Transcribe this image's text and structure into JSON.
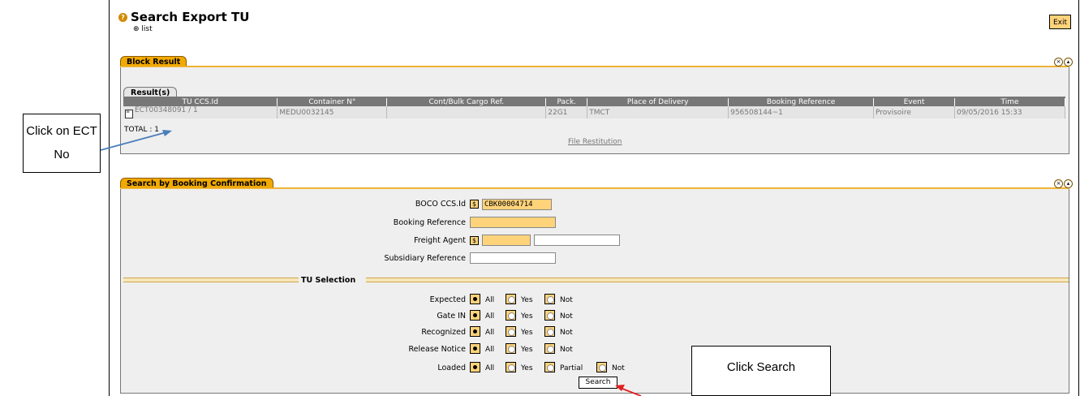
{
  "header": {
    "title": "Search Export TU",
    "list_link": "list",
    "exit_label": "Exit"
  },
  "block_result": {
    "tab_label": "Block Result",
    "results_tab": "Result(s)",
    "columns": [
      "TU CCS.Id",
      "Container N°",
      "Cont/Bulk Cargo Ref.",
      "Pack.",
      "Place of Delivery",
      "Booking Reference",
      "Event",
      "Time"
    ],
    "rows": [
      [
        "ECT00348091 / 1",
        "MEDU0032145",
        "",
        "22G1",
        "TMCT",
        "956508144~1",
        "Provisoire",
        "09/05/2016 15:33"
      ]
    ],
    "total_label": "TOTAL : 1",
    "file_restitution": "File Restitution"
  },
  "search_panel": {
    "tab_label": "Search by Booking Confirmation",
    "fields": {
      "boco_label": "BOCO CCS.Id",
      "boco_value": "CBK00004714",
      "booking_ref_label": "Booking Reference",
      "booking_ref_value": "",
      "freight_agent_label": "Freight Agent",
      "freight_agent_code": "",
      "freight_agent_name": "",
      "subsidiary_label": "Subsidiary Reference",
      "subsidiary_value": ""
    },
    "tu_selection_label": "TU Selection",
    "selection_rows": [
      {
        "label": "Expected",
        "options": [
          "All",
          "Yes",
          "Not"
        ],
        "selected": "All"
      },
      {
        "label": "Gate IN",
        "options": [
          "All",
          "Yes",
          "Not"
        ],
        "selected": "All"
      },
      {
        "label": "Recognized",
        "options": [
          "All",
          "Yes",
          "Not"
        ],
        "selected": "All"
      },
      {
        "label": "Release Notice",
        "options": [
          "All",
          "Yes",
          "Not"
        ],
        "selected": "All"
      },
      {
        "label": "Loaded",
        "options": [
          "All",
          "Yes",
          "Partial",
          "Not"
        ],
        "selected": "All"
      }
    ],
    "search_button": "Search"
  },
  "annotations": {
    "callout_ect": "Click on ECT No",
    "callout_search": "Click Search",
    "arrow_ect_color": "#4a7ebb",
    "arrow_search_color": "#e02020"
  },
  "colors": {
    "accent": "#f2a900",
    "field_yellow": "#ffd37a",
    "grid_header": "#777777"
  }
}
